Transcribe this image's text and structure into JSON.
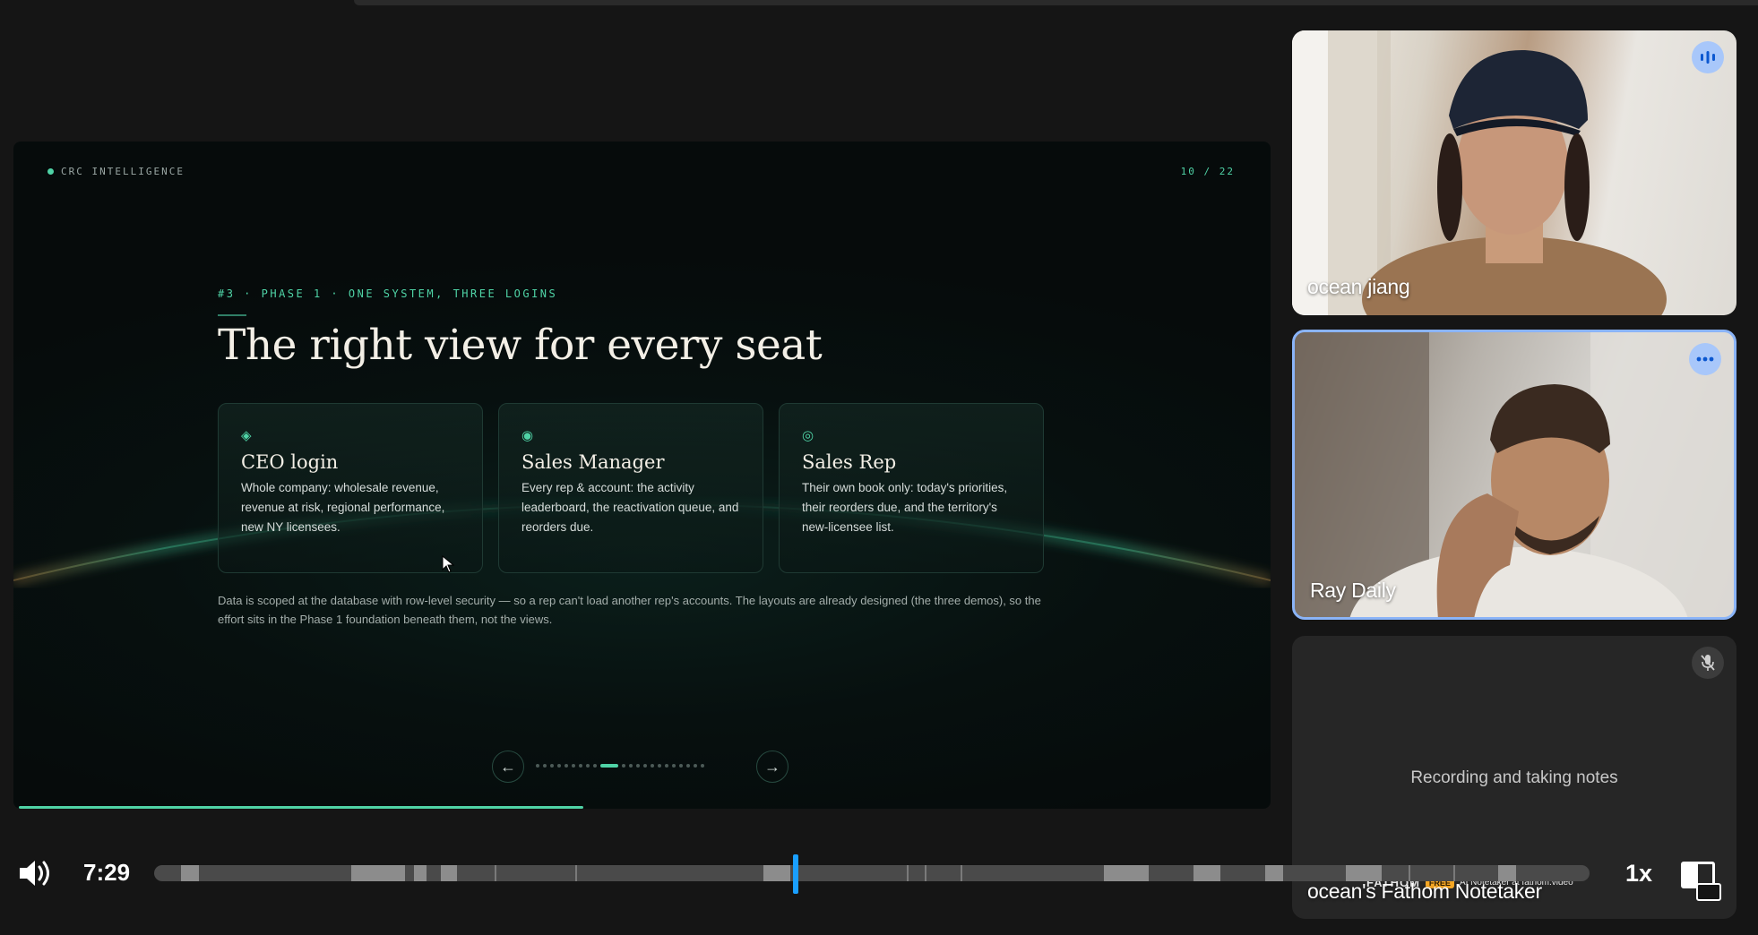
{
  "slide": {
    "brand": "CRC INTELLIGENCE",
    "counter": "10 / 22",
    "kicker": "#3 · PHASE 1 · ONE SYSTEM, THREE LOGINS",
    "title": "The right view for every seat",
    "cards": [
      {
        "icon": "◈",
        "icon_name": "diamond-icon",
        "title": "CEO login",
        "body": "Whole company: wholesale revenue, revenue at risk, regional performance, new NY licensees."
      },
      {
        "icon": "◉",
        "icon_name": "target-icon",
        "title": "Sales Manager",
        "body": "Every rep & account: the activity leaderboard, the reactivation queue, and reorders due."
      },
      {
        "icon": "◎",
        "icon_name": "circle-icon",
        "title": "Sales Rep",
        "body": "Their own book only: today's priorities, their reorders due, and the territory's new-licensee list."
      }
    ],
    "note": "Data is scoped at the database with row-level security — so a rep can't load another rep's accounts. The layouts are already designed (the three demos), so the effort sits in the Phase 1 foundation beneath them, not the views.",
    "prev": "←",
    "next": "→",
    "current_slide": 10,
    "total_slides": 22
  },
  "participants": [
    {
      "name": "ocean jiang",
      "badge": "speaking-icon"
    },
    {
      "name": "Ray Daily",
      "badge": "more-options-icon"
    },
    {
      "name": "ocean's Fathom Notetaker",
      "badge": "mic-off-icon",
      "status": "Recording and taking notes",
      "fathom_brand": "FATHOM",
      "fathom_free": "FREE",
      "fathom_text": "AI Notetaker at fathom.video"
    }
  ],
  "player": {
    "time": "7:29",
    "speed": "1x",
    "accent": "#1a9fff"
  },
  "colors": {
    "slide_accent": "#4fd3a6",
    "active_border": "#8ab4f8"
  }
}
